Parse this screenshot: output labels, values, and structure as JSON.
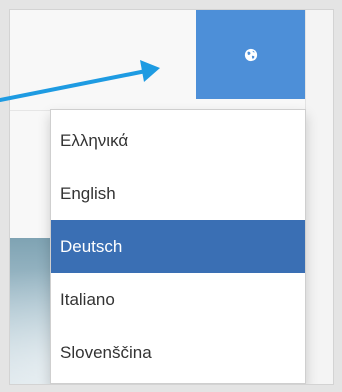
{
  "language_menu": {
    "button_icon": "globe-icon",
    "accent_color": "#4d8fd8",
    "selected_color": "#3a6fb4",
    "items": [
      {
        "label": "Ελληνικά",
        "selected": false
      },
      {
        "label": "English",
        "selected": false
      },
      {
        "label": "Deutsch",
        "selected": true
      },
      {
        "label": "Italiano",
        "selected": false
      },
      {
        "label": "Slovenščina",
        "selected": false
      }
    ]
  },
  "annotation": {
    "arrow_color": "#1e9be2",
    "arrow_icon": "pointer-arrow"
  }
}
